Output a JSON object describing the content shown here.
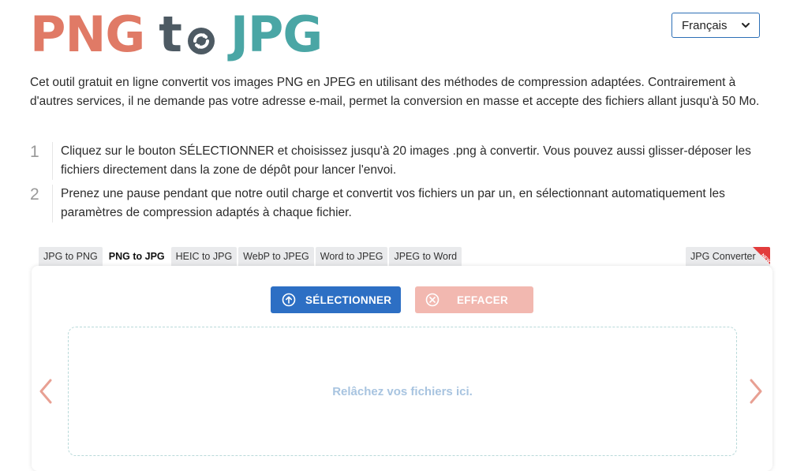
{
  "logo": {
    "part1": "PNG",
    "part2": "t",
    "part3": "JPG"
  },
  "language": {
    "selected": "Français"
  },
  "intro": "Cet outil gratuit en ligne convertit vos images PNG en JPEG en utilisant des méthodes de compression adaptées. Contrairement à d'autres services, il ne demande pas votre adresse e-mail, permet la conversion en masse et accepte des fichiers allant jusqu'à 50 Mo.",
  "steps": [
    {
      "num": "1",
      "text": "Cliquez sur le bouton SÉLECTIONNER et choisissez jusqu'à 20 images .png à convertir. Vous pouvez aussi glisser-déposer les fichiers directement dans la zone de dépôt pour lancer l'envoi."
    },
    {
      "num": "2",
      "text": "Prenez une pause pendant que notre outil charge et convertit vos fichiers un par un, en sélectionnant automatiquement les paramètres de compression adaptés à chaque fichier."
    }
  ],
  "tabs": [
    {
      "label": "JPG to PNG"
    },
    {
      "label": "PNG to JPG"
    },
    {
      "label": "HEIC to JPG"
    },
    {
      "label": "WebP to JPEG"
    },
    {
      "label": "Word to JPEG"
    },
    {
      "label": "JPEG to Word"
    }
  ],
  "tab_right": {
    "label": "JPG Converter",
    "ribbon": "NEW"
  },
  "buttons": {
    "select": "SÉLECTIONNER",
    "clear": "EFFACER"
  },
  "dropzone": {
    "text": "Relâchez vos fichiers ici."
  },
  "colors": {
    "png": "#e07a66",
    "to": "#4d5a63",
    "jpg": "#4aa6a5",
    "primary": "#2d6fc4",
    "clear": "#f2b8b0",
    "arrow": "#e8a093"
  }
}
